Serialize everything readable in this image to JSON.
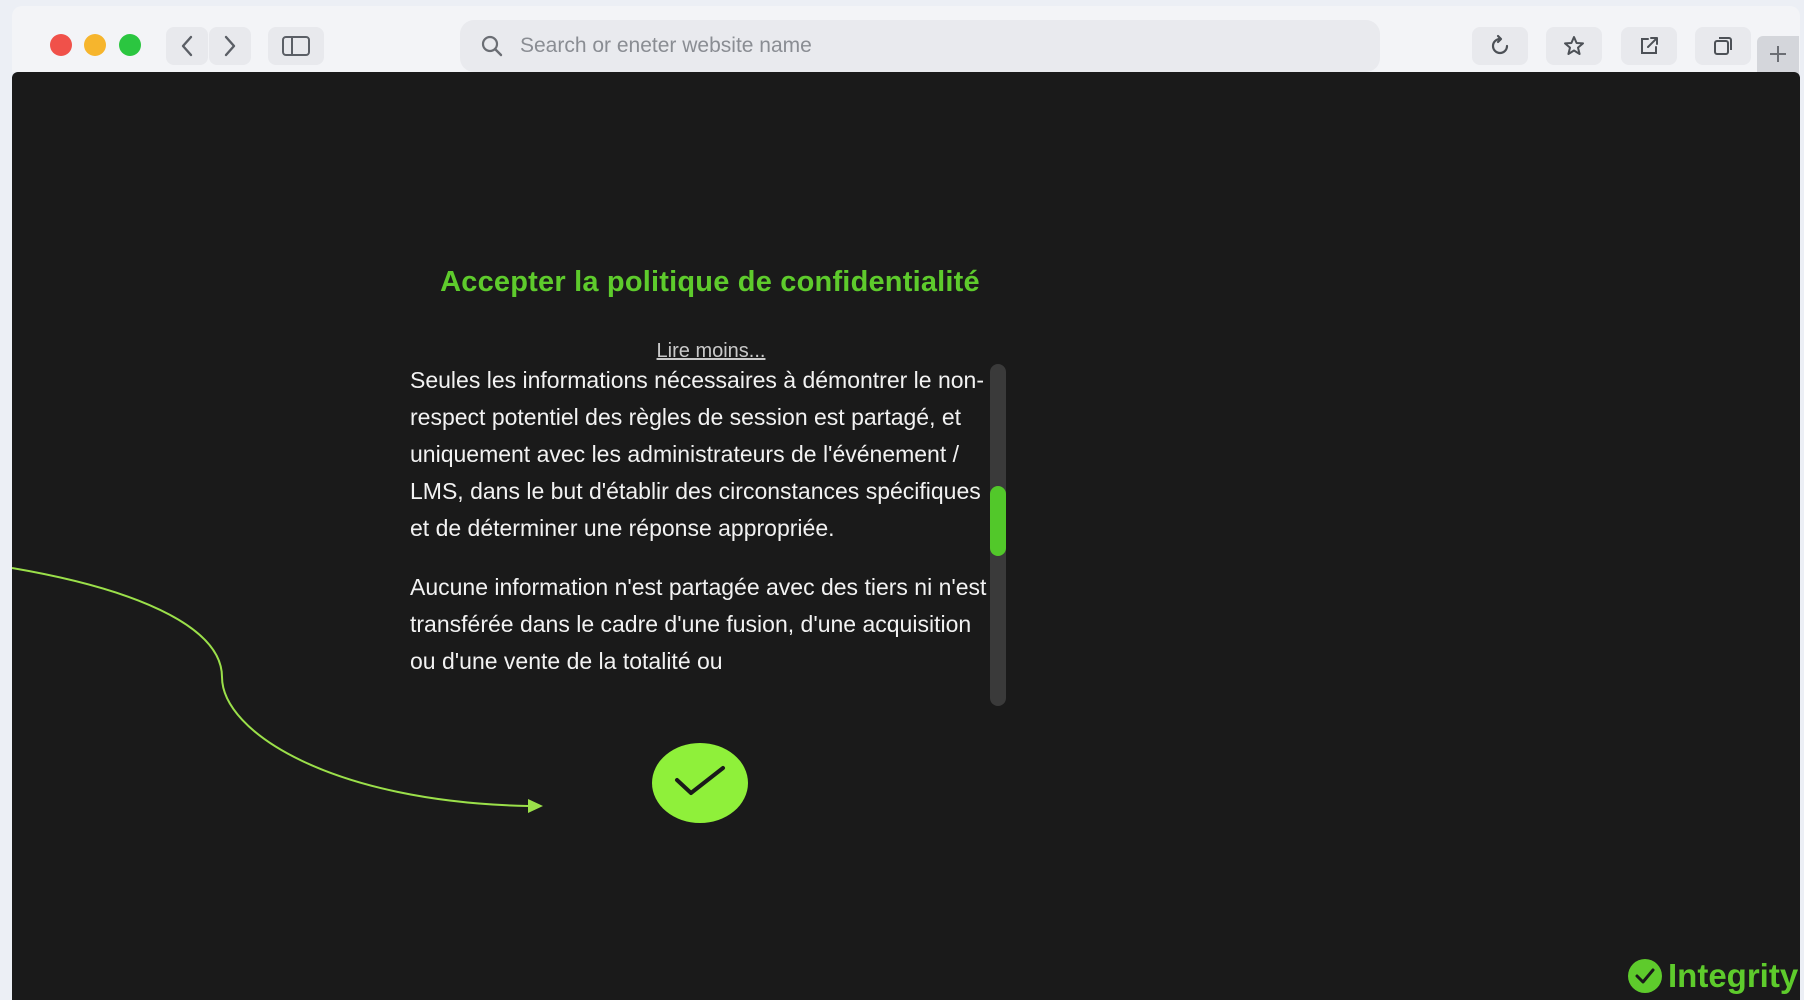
{
  "browser": {
    "address_placeholder": "Search or eneter website name",
    "icons": [
      "back-icon",
      "forward-icon",
      "sidebar-icon",
      "search-icon",
      "reload-icon",
      "star-icon",
      "share-icon",
      "tabs-icon",
      "plus-icon"
    ]
  },
  "modal": {
    "title": "Accepter la politique de confidentialité",
    "read_less": "Lire moins...",
    "paragraphs": [
      "Seules les informations nécessaires à démontrer le non-respect potentiel des règles de session est partagé, et uniquement avec les administrateurs de l'événement / LMS, dans le but d'établir des circonstances spécifiques et de déterminer une réponse appropriée.",
      "Aucune information n'est partagée avec des tiers ni n'est transférée dans le cadre d'une fusion, d'une acquisition ou d'une vente de la totalité ou"
    ],
    "scroll_position": 0.45,
    "accept_icon": "checkmark-icon"
  },
  "brand": {
    "name": "Integrity",
    "icon": "check-circle-icon"
  },
  "colors": {
    "accent": "#5ecb2c",
    "accept_button": "#8ff03a",
    "background": "#1a1a1a",
    "arrow": "#9be04a"
  }
}
